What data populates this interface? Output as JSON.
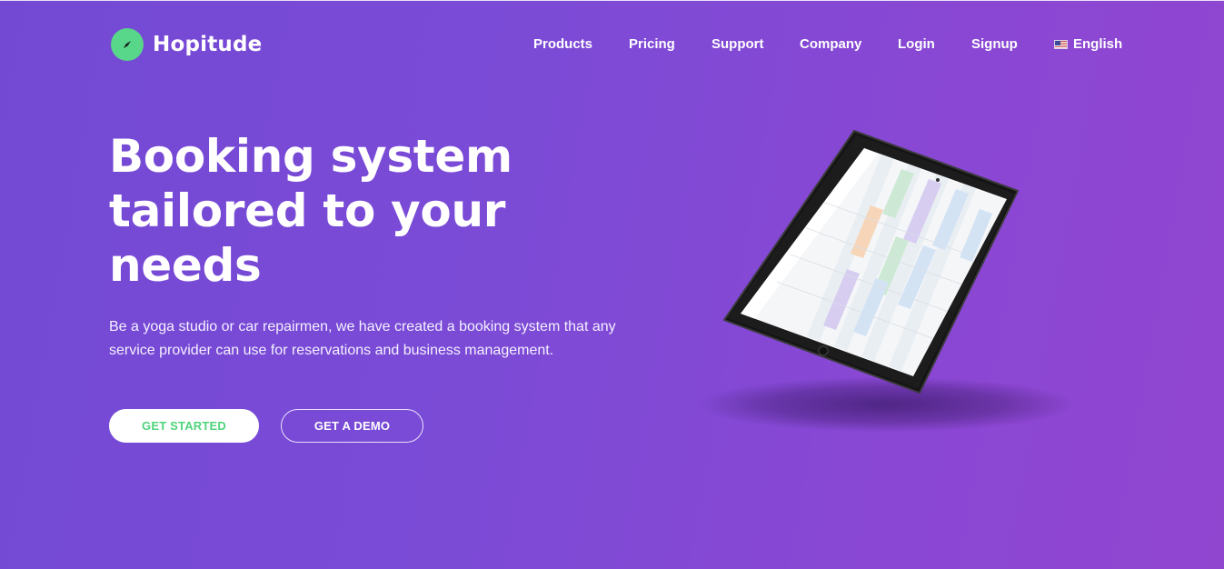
{
  "brand": {
    "name": "Hopitude",
    "logo_color": "#58d68a",
    "icon": "compass-icon"
  },
  "nav": {
    "items": [
      {
        "label": "Products"
      },
      {
        "label": "Pricing"
      },
      {
        "label": "Support"
      },
      {
        "label": "Company"
      },
      {
        "label": "Login"
      },
      {
        "label": "Signup"
      }
    ],
    "language": {
      "label": "English",
      "icon": "us-flag-icon"
    }
  },
  "hero": {
    "title": "Booking system tailored to your needs",
    "subtitle": "Be a yoga studio or car repairmen, we have created a booking system that any service provider can use for reservations and business management.",
    "cta_primary": "GET STARTED",
    "cta_secondary": "GET A DEMO"
  },
  "colors": {
    "background_start": "#7349d4",
    "background_end": "#9146d0",
    "accent_green": "#4fd47c"
  }
}
